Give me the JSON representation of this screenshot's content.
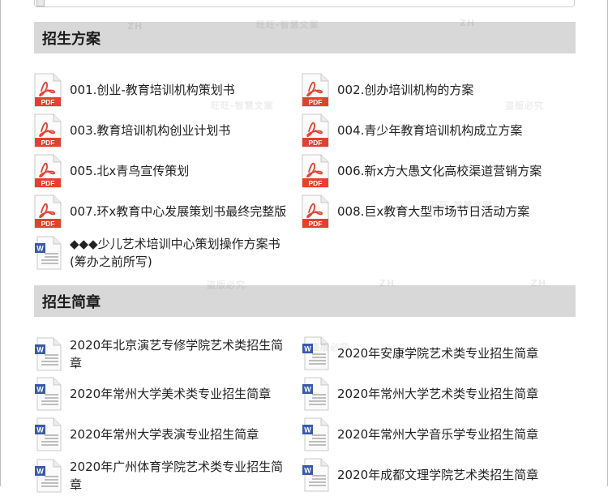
{
  "sections": [
    {
      "title": "招生方案",
      "items": [
        {
          "type": "pdf",
          "name": "001.创业-教育培训机构策划书"
        },
        {
          "type": "pdf",
          "name": "002.创办培训机构的方案"
        },
        {
          "type": "pdf",
          "name": "003.教育培训机构创业计划书"
        },
        {
          "type": "pdf",
          "name": "004.青少年教育培训机构成立方案"
        },
        {
          "type": "pdf",
          "name": "005.北x青鸟宣传策划"
        },
        {
          "type": "pdf",
          "name": "006.新x方大愚文化高校渠道营销方案"
        },
        {
          "type": "pdf",
          "name": "007.环x教育中心发展策划书最终完整版"
        },
        {
          "type": "pdf",
          "name": "008.巨x教育大型市场节日活动方案"
        },
        {
          "type": "word",
          "name": "◆◆◆少儿艺术培训中心策划操作方案书(筹办之前所写)"
        }
      ]
    },
    {
      "title": "招生简章",
      "items": [
        {
          "type": "word",
          "name": "2020年北京演艺专修学院艺术类招生简章"
        },
        {
          "type": "word",
          "name": "2020年安康学院艺术类专业招生简章"
        },
        {
          "type": "word",
          "name": "2020年常州大学美术类专业招生简章"
        },
        {
          "type": "word",
          "name": "2020年常州大学艺术类专业招生简章"
        },
        {
          "type": "word",
          "name": "2020年常州大学表演专业招生简章"
        },
        {
          "type": "word",
          "name": "2020年常州大学音乐学专业招生简章"
        },
        {
          "type": "word",
          "name": "2020年广州体育学院艺术类专业招生简章"
        },
        {
          "type": "word",
          "name": "2020年成都文理学院艺术类招生简章"
        }
      ]
    }
  ],
  "icons": {
    "pdf": "pdf-file-icon",
    "word": "word-document-icon"
  },
  "colors": {
    "header_bg": "#d8d8d8",
    "pdf_red": "#e2412f",
    "word_blue": "#3a5aa8"
  },
  "watermarks": [
    "ZH",
    "旺旺-智慧文案",
    "盗版必究",
    "ZH",
    "旺旺-智慧文案",
    "盗版必究",
    "盗版必究",
    "ZH",
    "ZH",
    "旺旺-智慧文案"
  ]
}
